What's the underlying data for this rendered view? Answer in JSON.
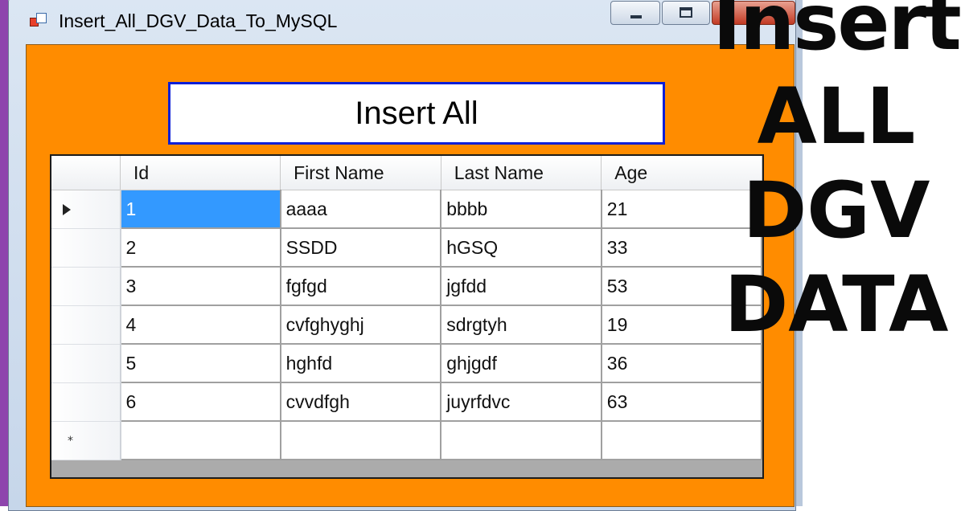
{
  "window": {
    "title": "Insert_All_DGV_Data_To_MySQL",
    "caption_buttons": {
      "minimize": "minimize",
      "maximize": "maximize",
      "close": "×"
    }
  },
  "form": {
    "background_color": "#ff8c00",
    "insert_button_label": "Insert All",
    "insert_button_border_color": "#0b1fd8"
  },
  "grid": {
    "columns": [
      "Id",
      "First Name",
      "Last Name",
      "Age"
    ],
    "rows": [
      [
        "1",
        "aaaa",
        "bbbb",
        "21"
      ],
      [
        "2",
        "SSDD",
        "hGSQ",
        "33"
      ],
      [
        "3",
        "fgfgd",
        "jgfdd",
        "53"
      ],
      [
        "4",
        "cvfghyghj",
        "sdrgtyh",
        "19"
      ],
      [
        "5",
        "hghfd",
        "ghjgdf",
        "36"
      ],
      [
        "6",
        "cvvdfgh",
        "juyrfdvc",
        "63"
      ]
    ],
    "current_row_marker": "▶",
    "new_row_marker": "*",
    "selected_cell_color": "#3399ff"
  },
  "overlay": {
    "lines": [
      "Insert",
      "ALL",
      "DGV",
      "DATA"
    ]
  }
}
